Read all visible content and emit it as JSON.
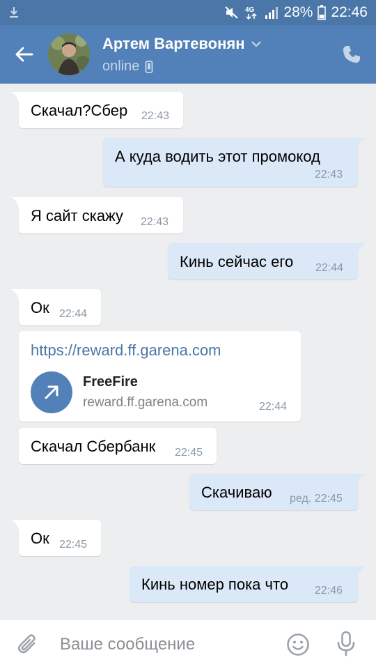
{
  "status_bar": {
    "battery_percent": "28%",
    "time": "22:46",
    "network": "4G"
  },
  "header": {
    "contact_name": "Артем Вартевонян",
    "status": "online"
  },
  "messages": [
    {
      "dir": "in",
      "text": "Скачал?Сбер",
      "time": "22:43"
    },
    {
      "dir": "out",
      "text": "А куда водить этот промокод",
      "time": "22:43"
    },
    {
      "dir": "in",
      "text": "Я сайт скажу",
      "time": "22:43"
    },
    {
      "dir": "out",
      "text": "Кинь сейчас его",
      "time": "22:44"
    },
    {
      "dir": "in",
      "text": "Ок",
      "time": "22:44"
    },
    {
      "dir": "in",
      "type": "link",
      "text": "https://reward.ff.garena.com",
      "link_title": "FreeFire",
      "link_domain": "reward.ff.garena.com",
      "time": "22:44"
    },
    {
      "dir": "in",
      "text": "Скачал Сбербанк",
      "time": "22:45"
    },
    {
      "dir": "out",
      "text": "Скачиваю",
      "time": "ред. 22:45"
    },
    {
      "dir": "in",
      "text": "Ок",
      "time": "22:45"
    },
    {
      "dir": "out",
      "text": "Кинь номер пока что",
      "time": "22:46"
    }
  ],
  "composer": {
    "placeholder": "Ваше сообщение"
  },
  "colors": {
    "header": "#5181b8",
    "status_bar": "#4a76a8",
    "background": "#edeef0",
    "incoming_bubble": "#ffffff",
    "outgoing_bubble": "#dbe8f7",
    "link": "#4a76a8"
  },
  "icons": {
    "back": "arrow-left-icon",
    "call": "phone-icon",
    "attach": "paperclip-icon",
    "emoji": "smiley-icon",
    "mic": "microphone-icon"
  }
}
